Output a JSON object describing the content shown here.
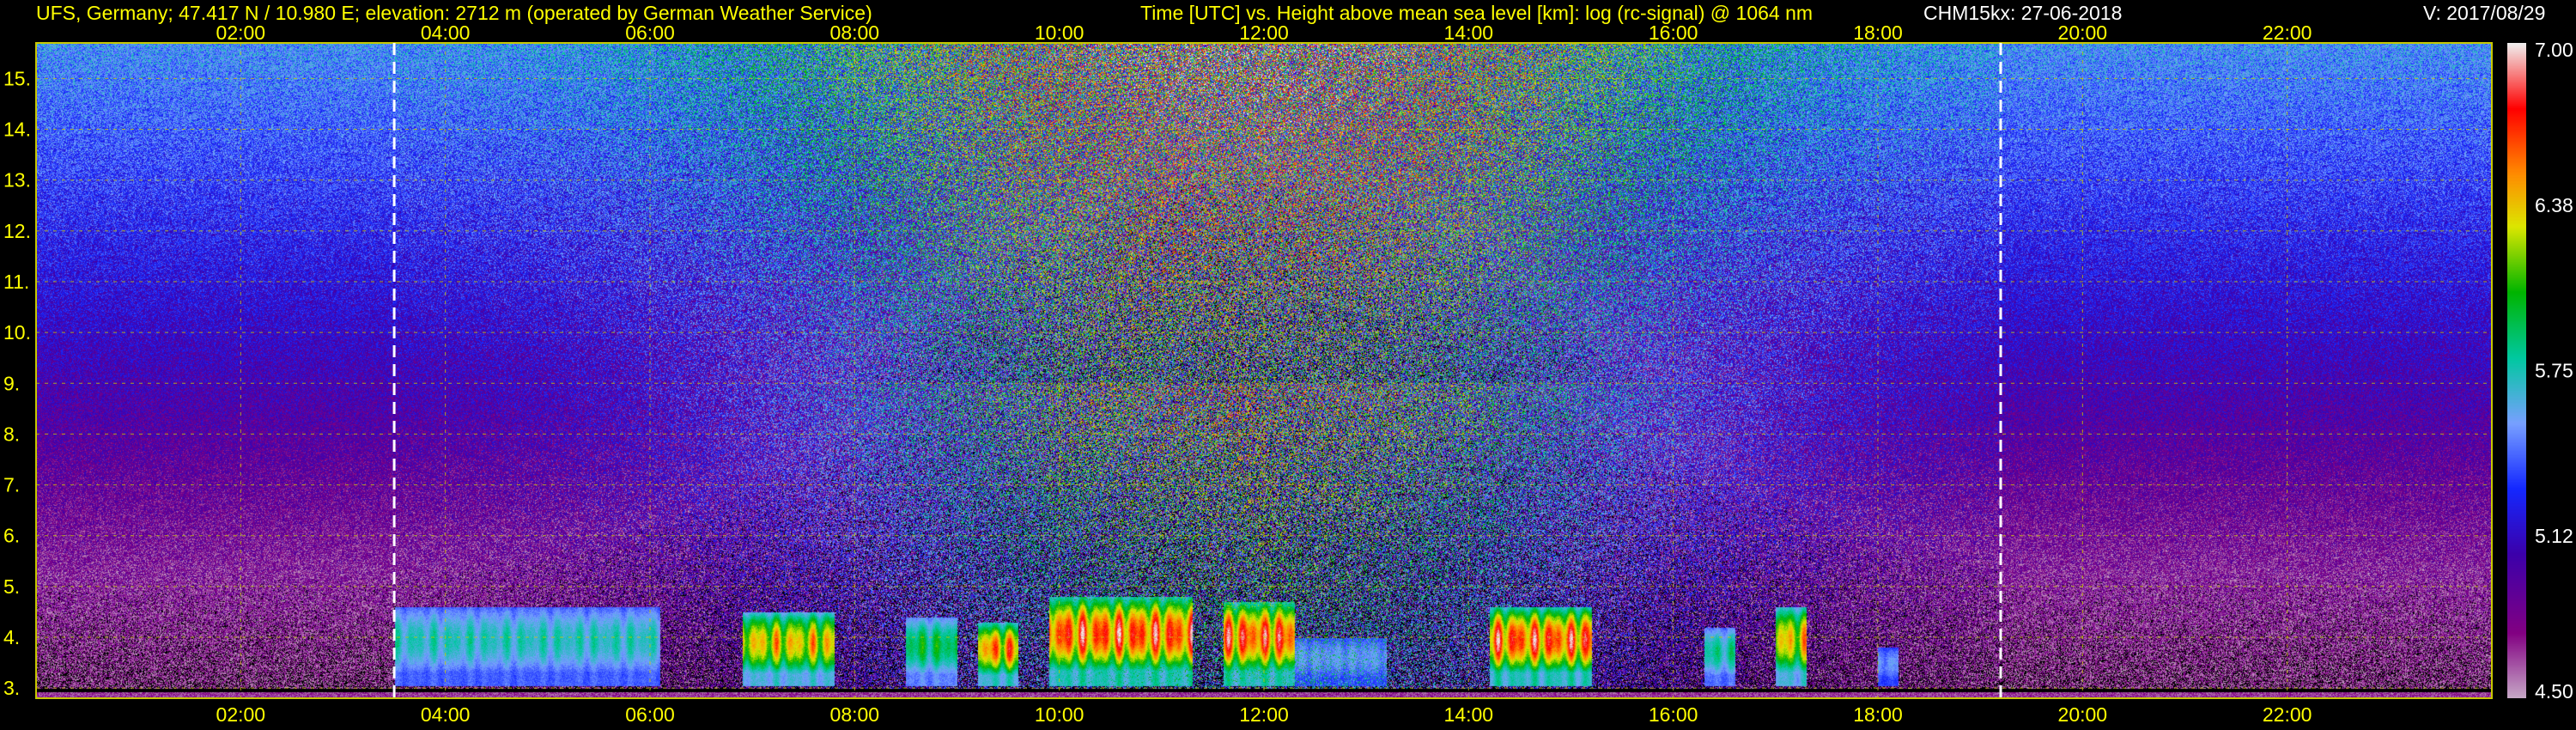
{
  "header": {
    "station": "UFS, Germany; 47.417 N / 10.980 E; elevation: 2712 m  (operated by German Weather Service)",
    "description": "Time [UTC] vs. Height above mean sea level [km]: log (rc-signal) @ 1064 nm",
    "instrument": "CHM15kx: 27-06-2018",
    "version": "V: 2017/08/29"
  },
  "colors": {
    "axis_text": "#ffff00",
    "grid": "#c8c800",
    "dashed_marker": "#ffffff"
  },
  "chart_data": {
    "type": "heatmap",
    "title": "Time [UTC] vs. Height above mean sea level [km]: log (rc-signal) @ 1064 nm",
    "xlabel": "Time [UTC]",
    "ylabel": "Height above mean sea level [km]",
    "x_ticks": [
      "02:00",
      "04:00",
      "06:00",
      "08:00",
      "10:00",
      "12:00",
      "14:00",
      "16:00",
      "18:00",
      "20:00",
      "22:00"
    ],
    "x_tick_hours": [
      2,
      4,
      6,
      8,
      10,
      12,
      14,
      16,
      18,
      20,
      22
    ],
    "xlim_hours": [
      0.0,
      24.0
    ],
    "y_ticks": [
      "3.",
      "4.",
      "5.",
      "6.",
      "7.",
      "8.",
      "9.",
      "10.",
      "11.",
      "12.",
      "13.",
      "14.",
      "15."
    ],
    "y_tick_values": [
      3,
      4,
      5,
      6,
      7,
      8,
      9,
      10,
      11,
      12,
      13,
      14,
      15
    ],
    "ylim_km": [
      2.8,
      15.7
    ],
    "grid": true,
    "dashed_markers_hours": [
      3.5,
      19.2
    ],
    "colorbar": {
      "labels": [
        "7.00",
        "6.38",
        "5.75",
        "5.12",
        "4.50"
      ],
      "values": [
        7.0,
        6.38,
        5.75,
        5.12,
        4.5
      ],
      "min": 4.5,
      "max": 7.0,
      "colors": [
        "#e8e8e8",
        "#ff0000",
        "#ff8000",
        "#ffff00",
        "#00c000",
        "#00ffc0",
        "#a0c0ff",
        "#0040ff",
        "#4000a0",
        "#800080",
        "#c0a0c0"
      ]
    },
    "cloud_events": [
      {
        "start_hour": 3.5,
        "end_hour": 6.1,
        "top_km": 4.6,
        "peak": 0.35
      },
      {
        "start_hour": 6.9,
        "end_hour": 7.8,
        "top_km": 4.5,
        "peak": 0.8
      },
      {
        "start_hour": 8.5,
        "end_hour": 9.0,
        "top_km": 4.4,
        "peak": 0.5
      },
      {
        "start_hour": 9.2,
        "end_hour": 9.6,
        "top_km": 4.3,
        "peak": 0.9
      },
      {
        "start_hour": 9.9,
        "end_hour": 11.3,
        "top_km": 4.8,
        "peak": 1.0
      },
      {
        "start_hour": 11.6,
        "end_hour": 12.3,
        "top_km": 4.7,
        "peak": 1.0
      },
      {
        "start_hour": 12.3,
        "end_hour": 13.2,
        "top_km": 4.0,
        "peak": 0.2
      },
      {
        "start_hour": 14.2,
        "end_hour": 15.2,
        "top_km": 4.6,
        "peak": 1.0
      },
      {
        "start_hour": 16.3,
        "end_hour": 16.6,
        "top_km": 4.2,
        "peak": 0.4
      },
      {
        "start_hour": 17.0,
        "end_hour": 17.3,
        "top_km": 4.6,
        "peak": 0.8
      },
      {
        "start_hour": 18.0,
        "end_hour": 18.2,
        "top_km": 3.8,
        "peak": 0.2
      }
    ]
  }
}
